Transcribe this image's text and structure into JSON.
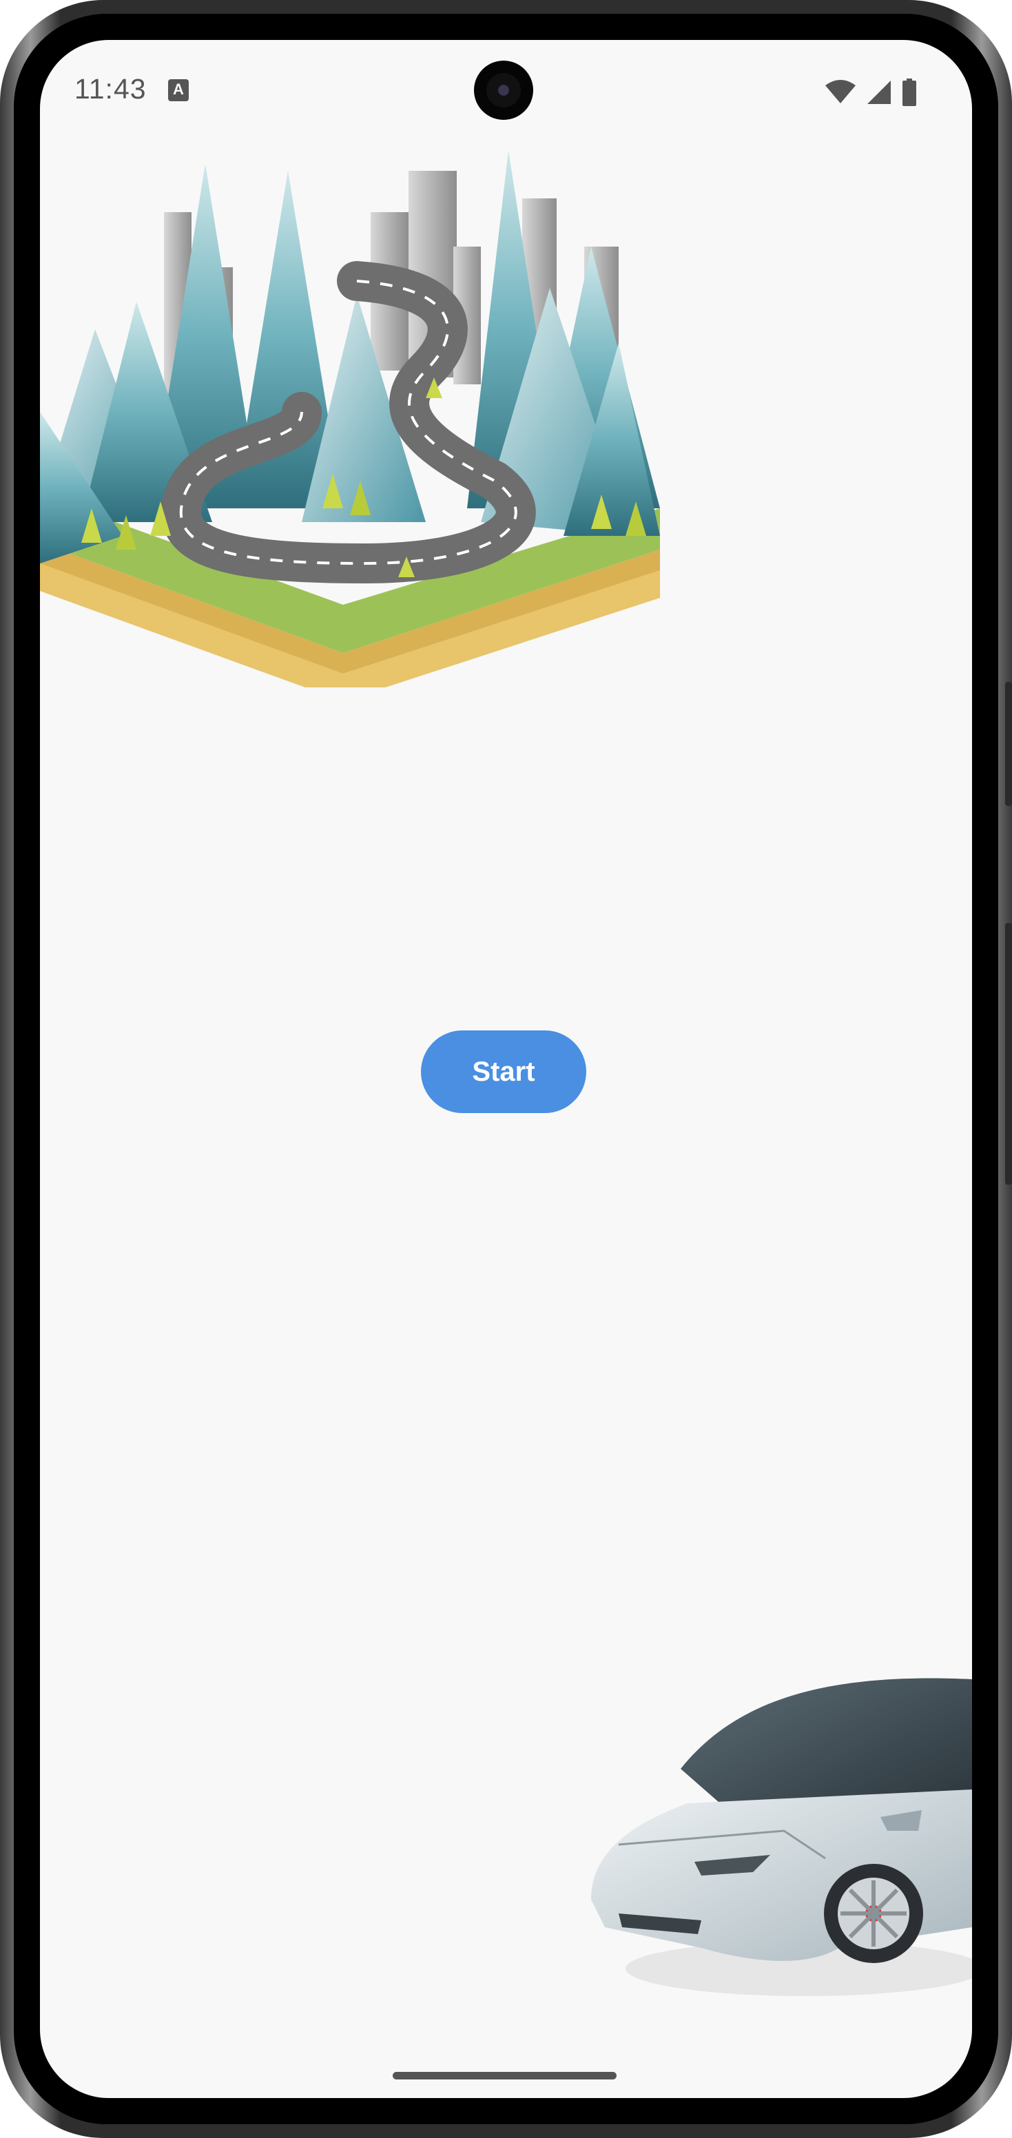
{
  "status_bar": {
    "time": "11:43",
    "notification_icon": "a-icon",
    "icons": [
      "wifi-icon",
      "signal-icon",
      "battery-icon"
    ]
  },
  "hero_image": {
    "description_icon": "winding-road-city-mountains-illustration"
  },
  "start_button": {
    "label": "Start"
  },
  "car_image": {
    "description_icon": "white-sports-car-illustration"
  },
  "colors": {
    "button": "#4a8fe2",
    "background": "#f8f8f8",
    "status_text": "#555555"
  }
}
